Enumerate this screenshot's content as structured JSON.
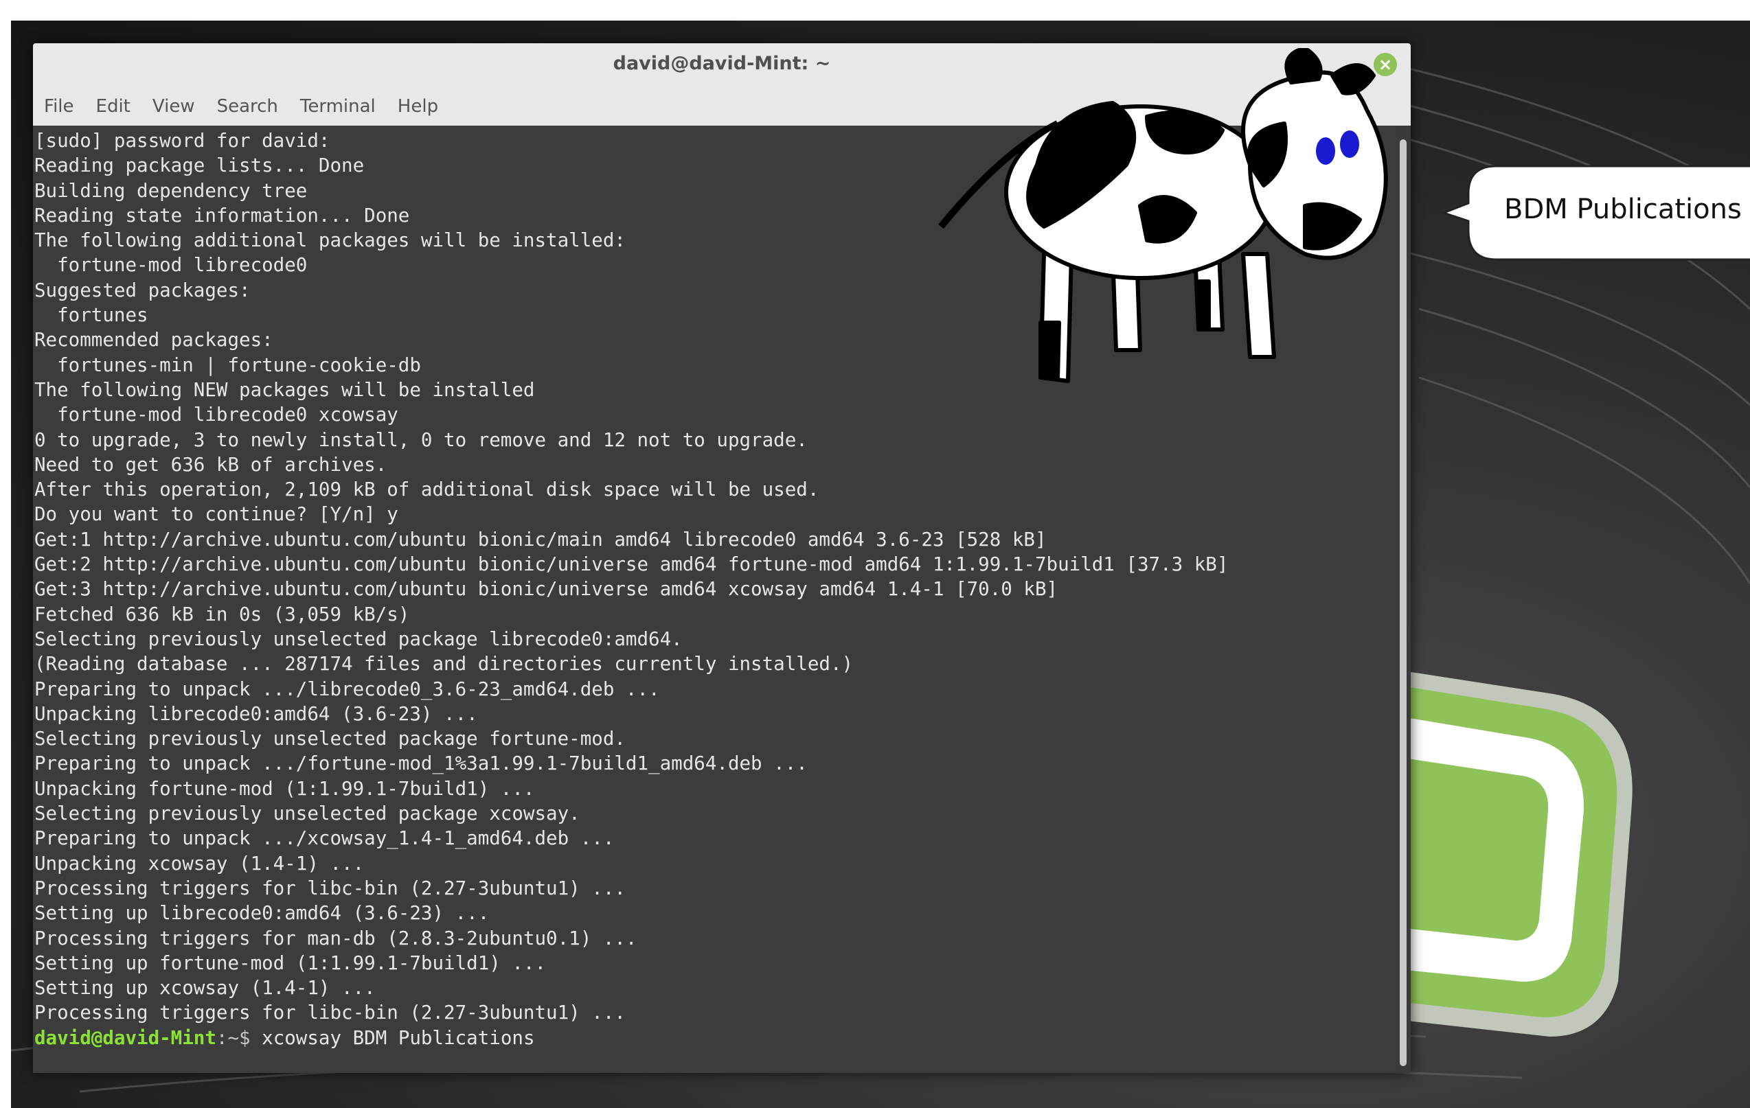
{
  "window": {
    "title": "david@david-Mint: ~"
  },
  "menu": [
    "File",
    "Edit",
    "View",
    "Search",
    "Terminal",
    "Help"
  ],
  "terminal": {
    "lines": [
      "[sudo] password for david:",
      "Reading package lists... Done",
      "Building dependency tree",
      "Reading state information... Done",
      "The following additional packages will be installed:",
      "  fortune-mod librecode0",
      "Suggested packages:",
      "  fortunes",
      "Recommended packages:",
      "  fortunes-min | fortune-cookie-db",
      "The following NEW packages will be installed",
      "  fortune-mod librecode0 xcowsay",
      "0 to upgrade, 3 to newly install, 0 to remove and 12 not to upgrade.",
      "Need to get 636 kB of archives.",
      "After this operation, 2,109 kB of additional disk space will be used.",
      "Do you want to continue? [Y/n] y",
      "Get:1 http://archive.ubuntu.com/ubuntu bionic/main amd64 librecode0 amd64 3.6-23 [528 kB]",
      "Get:2 http://archive.ubuntu.com/ubuntu bionic/universe amd64 fortune-mod amd64 1:1.99.1-7build1 [37.3 kB]",
      "Get:3 http://archive.ubuntu.com/ubuntu bionic/universe amd64 xcowsay amd64 1.4-1 [70.0 kB]",
      "Fetched 636 kB in 0s (3,059 kB/s)",
      "Selecting previously unselected package librecode0:amd64.",
      "(Reading database ... 287174 files and directories currently installed.)",
      "Preparing to unpack .../librecode0_3.6-23_amd64.deb ...",
      "Unpacking librecode0:amd64 (3.6-23) ...",
      "Selecting previously unselected package fortune-mod.",
      "Preparing to unpack .../fortune-mod_1%3a1.99.1-7build1_amd64.deb ...",
      "Unpacking fortune-mod (1:1.99.1-7build1) ...",
      "Selecting previously unselected package xcowsay.",
      "Preparing to unpack .../xcowsay_1.4-1_amd64.deb ...",
      "Unpacking xcowsay (1.4-1) ...",
      "Processing triggers for libc-bin (2.27-3ubuntu1) ...",
      "Setting up librecode0:amd64 (3.6-23) ...",
      "Processing triggers for man-db (2.8.3-2ubuntu0.1) ...",
      "Setting up fortune-mod (1:1.99.1-7build1) ...",
      "Setting up xcowsay (1.4-1) ...",
      "Processing triggers for libc-bin (2.27-3ubuntu1) ..."
    ],
    "prompt_user": "david@david-Mint",
    "prompt_path": ":~$ ",
    "command": "xcowsay BDM Publications"
  },
  "xcowsay": {
    "bubble_text": "BDM Publications"
  },
  "colors": {
    "prompt_green": "#8ae234",
    "mint_green": "#8fc35a",
    "terminal_bg": "#3c3c3c"
  },
  "icons": {
    "close": "close-icon",
    "logo": "linux-mint-logo",
    "mascot": "cow-icon"
  }
}
